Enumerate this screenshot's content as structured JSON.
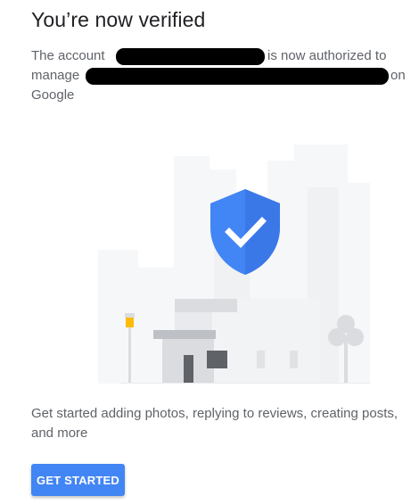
{
  "dialog": {
    "title": "You’re now verified",
    "message": {
      "line1_prefix": "The account",
      "line1_suffix": "is now authorized to",
      "line2_prefix": "manage",
      "line2_suffix": "on",
      "line3": "Google"
    },
    "illustration": {
      "icon": "shield-check-icon",
      "shield_color": "#4285f4"
    },
    "description": "Get started adding photos, replying to reviews, creating posts, and more",
    "primary_button": {
      "label": "GET STARTED",
      "color": "#4285f4"
    }
  }
}
